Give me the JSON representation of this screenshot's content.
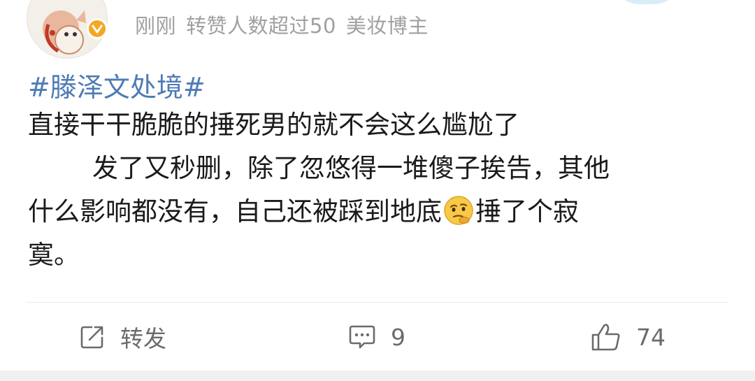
{
  "header": {
    "time": "刚刚",
    "repost_note": "转赞人数超过50",
    "tag": "美妆博主",
    "verified_color": "#f5a623"
  },
  "post": {
    "hashtag": "#滕泽文处境#",
    "lines": [
      "直接干干脆脆的捶死男的就不会这么尴尬了",
      "发了又秒删，除了忽悠得一堆傻子挨告，其他",
      "什么影响都没有，自己还被踩到地底",
      "捶了个寂",
      "寞。"
    ],
    "emoji": "thinking-face-emoji",
    "hashtag_color": "#4d7bb5"
  },
  "actions": {
    "repost_label": "转发",
    "comment_count": "9",
    "like_count": "74",
    "repost_icon": "share-edit-icon",
    "comment_icon": "comment-bubble-icon",
    "like_icon": "thumbs-up-icon"
  }
}
